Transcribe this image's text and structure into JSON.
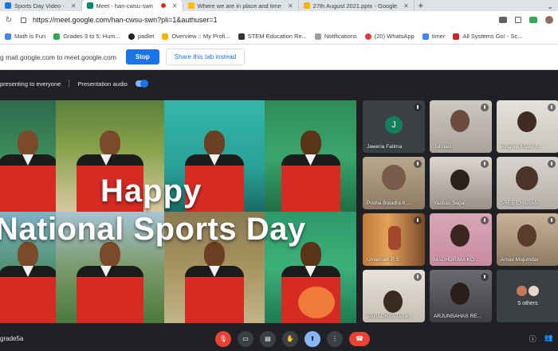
{
  "browser": {
    "tabs": [
      {
        "title": "Sports Day Video -",
        "active": false,
        "favicon_color": "#1a73e8"
      },
      {
        "title": "Meet - han-cwsu-swn",
        "active": true,
        "favicon_color": "#00897b",
        "recording": true
      },
      {
        "title": "Where we are in place and time",
        "active": false,
        "favicon_color": "#fbbc04"
      },
      {
        "title": "27th August 2021.pptx - Google",
        "active": false,
        "favicon_color": "#f4b400"
      }
    ],
    "new_tab": "+",
    "url": "https://meet.google.com/han-cwsu-swn?pli=1&authuser=1"
  },
  "bookmarks": [
    {
      "label": "Math is Fun",
      "color": "#4285f4"
    },
    {
      "label": "Grades 3 to 5: Hum...",
      "color": "#34a853"
    },
    {
      "label": "padlet",
      "color": "#222222"
    },
    {
      "label": "Overview :: My Profi...",
      "color": "#f4b400"
    },
    {
      "label": "STEM Education Re...",
      "color": "#333333"
    },
    {
      "label": "Notifications",
      "color": "#9e9e9e"
    },
    {
      "label": "(20) WhatsApp",
      "color": "#e53935"
    },
    {
      "label": "timer",
      "color": "#4285f4"
    },
    {
      "label": "All Systems Go! - Sc...",
      "color": "#c62828"
    }
  ],
  "share_bar": {
    "message": "g mail.google.com to meet.google.com",
    "stop_label": "Stop",
    "hide_label": "Share this tab instead"
  },
  "meet_bar": {
    "presenting_text": "presenting to everyone",
    "audio_label": "Presentation audio"
  },
  "presentation": {
    "line1": "Happy",
    "line2": "National Sports Day"
  },
  "participants": [
    {
      "name": "Jaweria Fatima",
      "avatar_letter": "J"
    },
    {
      "name": "Jahnavi..",
      "avatar_letter": ""
    },
    {
      "name": "Atharva Khare S...",
      "avatar_letter": ""
    },
    {
      "name": "Prisha Botadra K...",
      "avatar_letter": ""
    },
    {
      "name": "Yashas Sega",
      "avatar_letter": ""
    },
    {
      "name": "SREE CHARAN...",
      "avatar_letter": ""
    },
    {
      "name": "Umarnath P S",
      "avatar_letter": ""
    },
    {
      "name": "MADHURIMA KO...",
      "avatar_letter": ""
    },
    {
      "name": "Arnav Majumdar",
      "avatar_letter": ""
    },
    {
      "name": "AARADHYA TALA...",
      "avatar_letter": ""
    },
    {
      "name": "ARJUNSAHAS RE...",
      "avatar_letter": ""
    },
    {
      "name": "",
      "avatar_letter": ""
    }
  ],
  "others_label": "5 others",
  "controls": {
    "meeting_code": "grade5a"
  }
}
